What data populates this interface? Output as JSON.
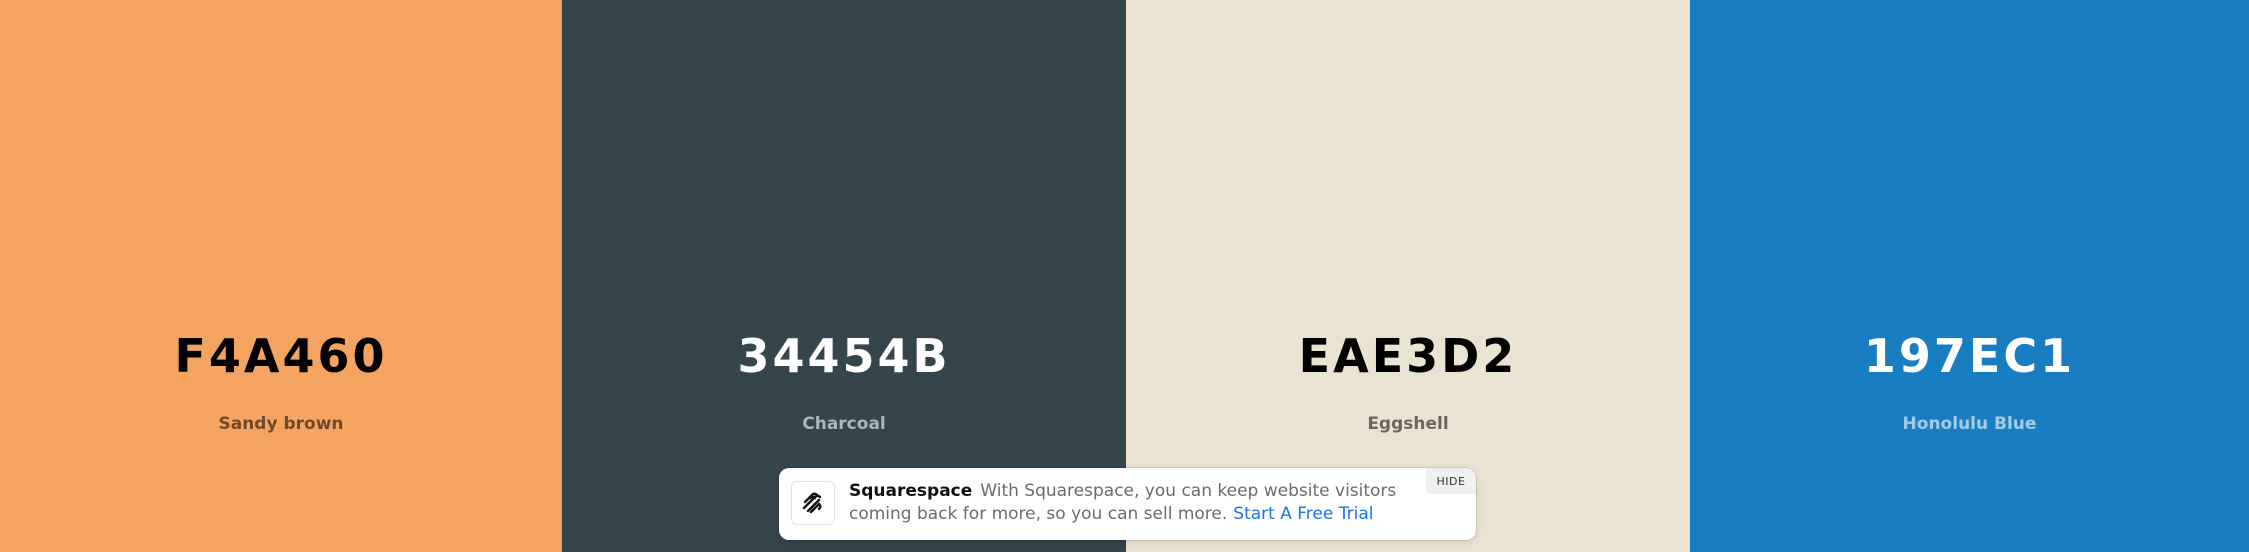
{
  "palette": {
    "colors": [
      {
        "hex": "F4A460",
        "name": "Sandy brown",
        "color": "#F4A460"
      },
      {
        "hex": "34454B",
        "name": "Charcoal",
        "color": "#34454B"
      },
      {
        "hex": "EAE3D2",
        "name": "Eggshell",
        "color": "#EAE3D2"
      },
      {
        "hex": "197EC1",
        "name": "Honolulu Blue",
        "color": "#197EC1"
      }
    ]
  },
  "ad": {
    "brand": "Squarespace",
    "message": "With Squarespace, you can keep website visitors coming back for more, so you can sell more.",
    "cta": "Start A Free Trial",
    "hide_label": "HIDE",
    "logo_icon": "squarespace-logo-icon",
    "link_color": "#1a73e8"
  }
}
